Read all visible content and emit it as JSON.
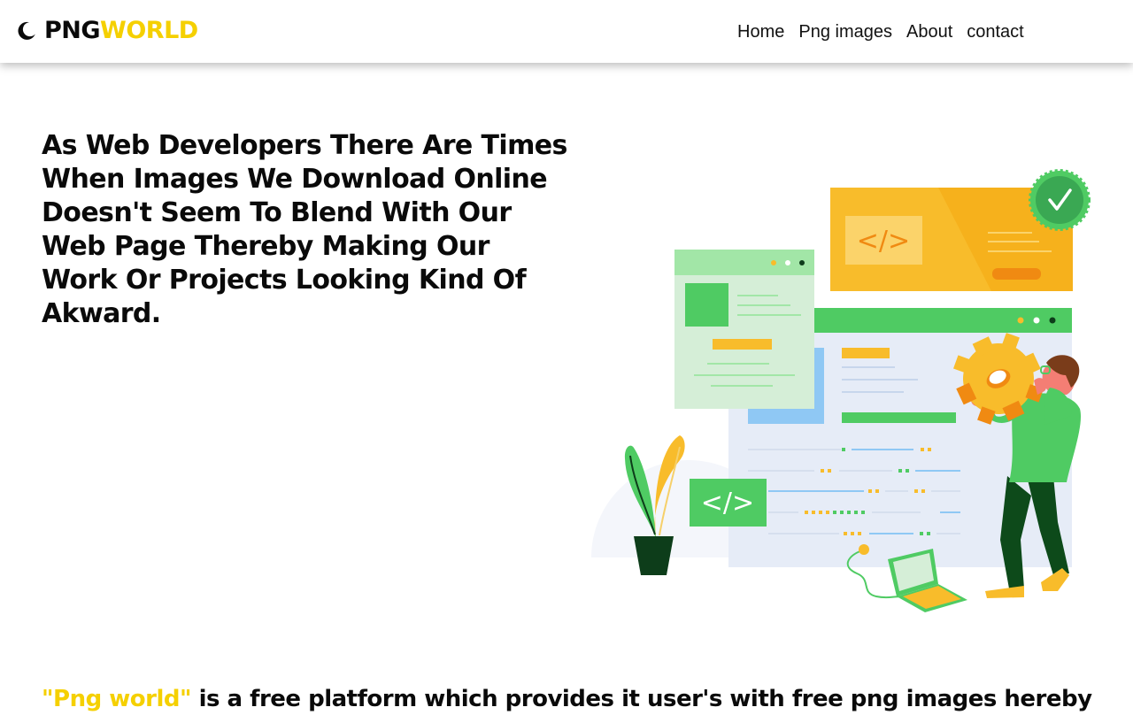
{
  "nav": {
    "logo_png": "PNG",
    "logo_world": "WORLD",
    "links": [
      "Home",
      "Png images",
      "About",
      "contact"
    ]
  },
  "hero": {
    "heading": "As Web Developers There Are Times When Images We Download Online Doesn't Seem To Blend With Our Web Page Thereby Making Our Work Or Projects Looking Kind Of Akward.",
    "illustration_text": [
      "</>",
      "</>"
    ]
  },
  "intro": {
    "brand": "\"Png world\"",
    "text": " is a free platform which provides it user's with free png images hereby"
  },
  "colors": {
    "accent_yellow": "#f5d000",
    "illustration_green": "#4fcb63",
    "illustration_orange": "#f8bc2b"
  }
}
